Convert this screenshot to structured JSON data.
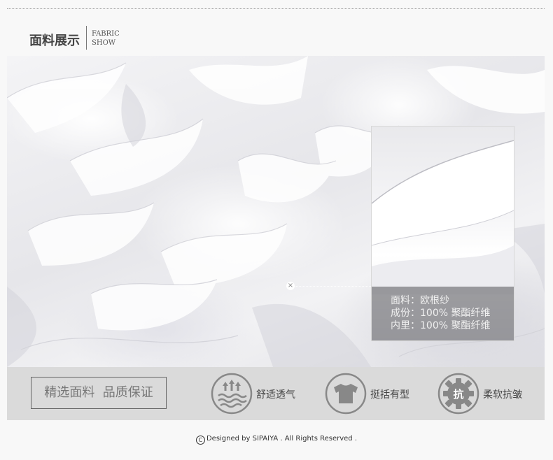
{
  "header": {
    "title": "面料展示",
    "title_en_line1": "FABRIC",
    "title_en_line2": "SHOW"
  },
  "fabric_info": {
    "fabric": "面料：欧根纱",
    "composition": "成份：100% 聚酯纤维",
    "lining": "内里：100% 聚酯纤维"
  },
  "features_bar": {
    "slogan": "精选面料  品质保证",
    "items": [
      {
        "label": "舒适透气",
        "icon": "breathable-arrows-icon"
      },
      {
        "label": "挺括有型",
        "icon": "tshirt-icon"
      },
      {
        "label": "柔软抗皱",
        "icon": "gear-kang-icon",
        "glyph": "抗"
      }
    ]
  },
  "footer": {
    "copyright_symbol": "C",
    "text": "Designed by SIPAIYA . All Rights Reserved ."
  },
  "colors": {
    "icon_gray": "#888888",
    "bar_bg": "#dadada",
    "info_overlay": "#646469"
  }
}
